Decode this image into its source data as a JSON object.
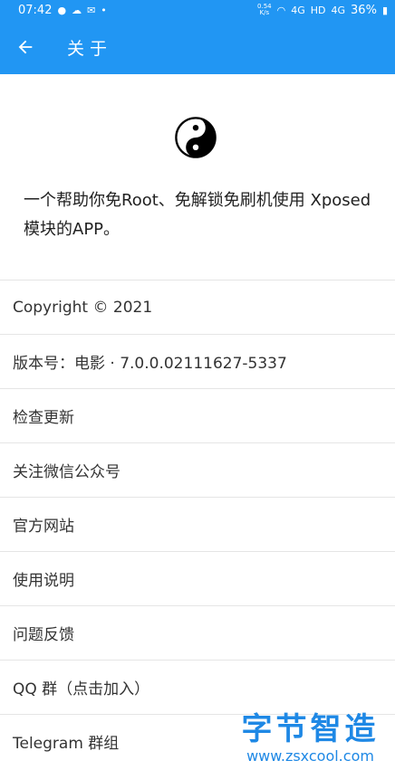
{
  "status_bar": {
    "time": "07:42",
    "net_speed": "0.54",
    "net_unit": "K/s",
    "signal_1": "4G",
    "hd": "HD",
    "signal_2": "4G",
    "battery": "36%"
  },
  "app_bar": {
    "title": "关于",
    "back_icon": "arrow-left-icon"
  },
  "header": {
    "logo_icon": "yin-yang-icon",
    "tagline": "一个帮助你免Root、免解锁免刷机使用 Xposed 模块的APP。"
  },
  "menu": {
    "items": [
      {
        "label": "Copyright © 2021"
      },
      {
        "label": "版本号：电影 · 7.0.0.02111627-5337"
      },
      {
        "label": "检查更新"
      },
      {
        "label": "关注微信公众号"
      },
      {
        "label": "官方网站"
      },
      {
        "label": "使用说明"
      },
      {
        "label": "问题反馈"
      },
      {
        "label": "QQ 群（点击加入）"
      },
      {
        "label": "Telegram 群组"
      }
    ]
  },
  "watermark": {
    "title": "字节智造",
    "url": "www.zsxcool.com"
  },
  "colors": {
    "primary": "#2196F3",
    "watermark": "#1E88E5"
  }
}
